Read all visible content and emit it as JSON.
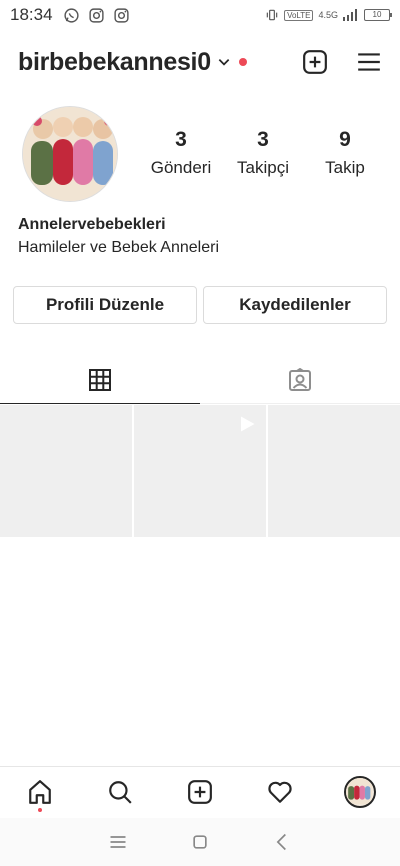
{
  "status_bar": {
    "time": "18:34",
    "network": "4.5G",
    "volte": "VoLTE",
    "battery": "10"
  },
  "header": {
    "username": "birbebekannesi0"
  },
  "profile": {
    "stats": [
      {
        "count": "3",
        "label": "Gönderi"
      },
      {
        "count": "3",
        "label": "Takipçi"
      },
      {
        "count": "9",
        "label": "Takip"
      }
    ],
    "name": "Annelervebebekleri",
    "bio": "Hamileler ve Bebek Anneleri"
  },
  "buttons": {
    "edit_profile": "Profili Düzenle",
    "saved": "Kaydedilenler"
  },
  "colors": {
    "accent_red": "#ed4956",
    "placeholder_tile": "#efefef",
    "text": "#262626"
  }
}
